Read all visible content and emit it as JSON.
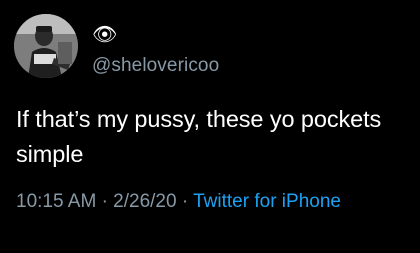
{
  "user": {
    "display_name": "👁",
    "handle": "@shelovericoo",
    "avatar_icon": "profile-photo"
  },
  "tweet": {
    "text": "If that’s my pussy, these yo pockets simple"
  },
  "meta": {
    "time": "10:15 AM",
    "separator": "·",
    "date": "2/26/20",
    "source": "Twitter for iPhone"
  },
  "colors": {
    "background": "#000000",
    "text": "#ffffff",
    "secondary": "#8899a6",
    "link": "#1da1f2"
  }
}
